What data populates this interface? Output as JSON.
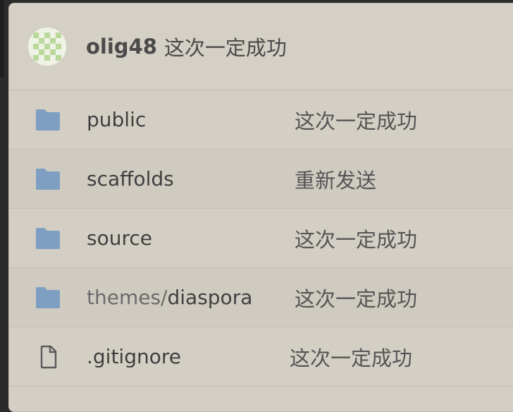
{
  "header": {
    "author": "olig48",
    "message": "这次一定成功"
  },
  "files": [
    {
      "type": "folder",
      "name_prefix": "",
      "name": "public",
      "message": "这次一定成功"
    },
    {
      "type": "folder",
      "name_prefix": "",
      "name": "scaffolds",
      "message": "重新发送"
    },
    {
      "type": "folder",
      "name_prefix": "",
      "name": "source",
      "message": "这次一定成功"
    },
    {
      "type": "folder",
      "name_prefix": "themes/",
      "name": "diaspora",
      "message": "这次一定成功"
    },
    {
      "type": "file",
      "name_prefix": "",
      "name": ".gitignore",
      "message": "这次一定成功"
    }
  ],
  "icons": {
    "folder": "folder-icon",
    "file": "file-icon"
  },
  "colors": {
    "background": "#d3cfc5",
    "folder": "#7f9fc2",
    "text": "#3f3f3f"
  }
}
